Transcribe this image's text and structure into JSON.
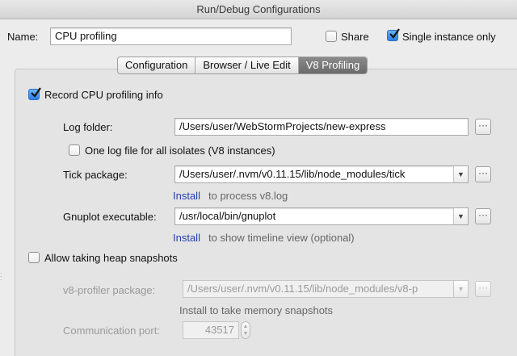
{
  "window": {
    "title": "Run/Debug Configurations"
  },
  "header": {
    "name_label": "Name:",
    "name_value": "CPU profiling",
    "share_label": "Share",
    "share_checked": false,
    "single_instance_label": "Single instance only",
    "single_instance_checked": true
  },
  "tabs": [
    {
      "label": "Configuration",
      "active": false
    },
    {
      "label": "Browser / Live Edit",
      "active": false
    },
    {
      "label": "V8 Profiling",
      "active": true
    }
  ],
  "v8": {
    "record_cpu_label": "Record CPU profiling info",
    "record_cpu_checked": true,
    "log_folder_label": "Log folder:",
    "log_folder_value": "/Users/user/WebStormProjects/new-express",
    "one_log_label": "One log file for all isolates (V8 instances)",
    "one_log_checked": false,
    "tick_package_label": "Tick package:",
    "tick_package_value": "/Users/user/.nvm/v0.11.15/lib/node_modules/tick",
    "tick_install_link": "Install",
    "tick_install_text": "to process v8.log",
    "gnuplot_label": "Gnuplot executable:",
    "gnuplot_value": "/usr/local/bin/gnuplot",
    "gnuplot_install_link": "Install",
    "gnuplot_install_text": "to show timeline view (optional)",
    "heap_label": "Allow taking heap snapshots",
    "heap_checked": false,
    "profiler_package_label": "v8-profiler package:",
    "profiler_package_value": "/Users/user/.nvm/v0.11.15/lib/node_modules/v8-p",
    "profiler_install_text": "Install to take memory snapshots",
    "port_label": "Communication port:",
    "port_value": "43517"
  },
  "icons": {
    "browse": "ellipsis-icon",
    "dropdown": "chevron-down-icon",
    "spinner": "up-down-arrows-icon"
  },
  "colors": {
    "link": "#2440b3",
    "checkbox_checked": "#2a7ee6",
    "active_tab": "#6b6b6b"
  }
}
